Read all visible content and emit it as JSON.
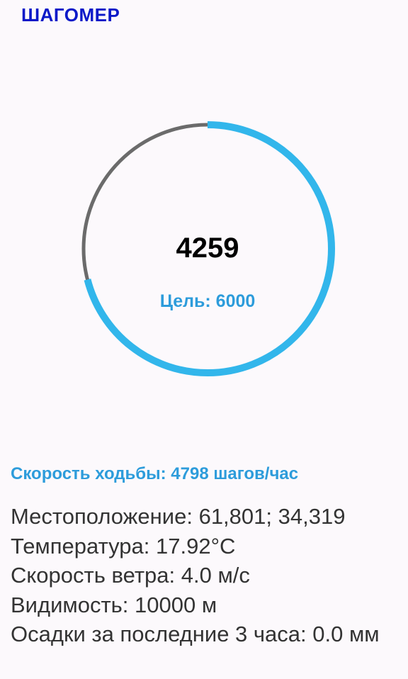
{
  "header": {
    "title": "ШАГОМЕР"
  },
  "pedometer": {
    "steps": "4259",
    "goal_label": "Цель: 6000",
    "progress_fraction": 0.7098,
    "colors": {
      "progress": "#32B6EB",
      "track": "#6B6B6B"
    }
  },
  "walking_speed": {
    "label": "Скорость ходьбы:",
    "value": "4798 шагов/час"
  },
  "info": {
    "location_label": "Местоположение:",
    "location_value": "61,801; 34,319",
    "temperature_label": "Температура:",
    "temperature_value": "17.92°C",
    "wind_label": "Скорость ветра:",
    "wind_value": "4.0 м/с",
    "visibility_label": "Видимость:",
    "visibility_value": "10000 м",
    "precip_label": "Осадки за последние 3 часа:",
    "precip_value": "0.0 мм"
  }
}
